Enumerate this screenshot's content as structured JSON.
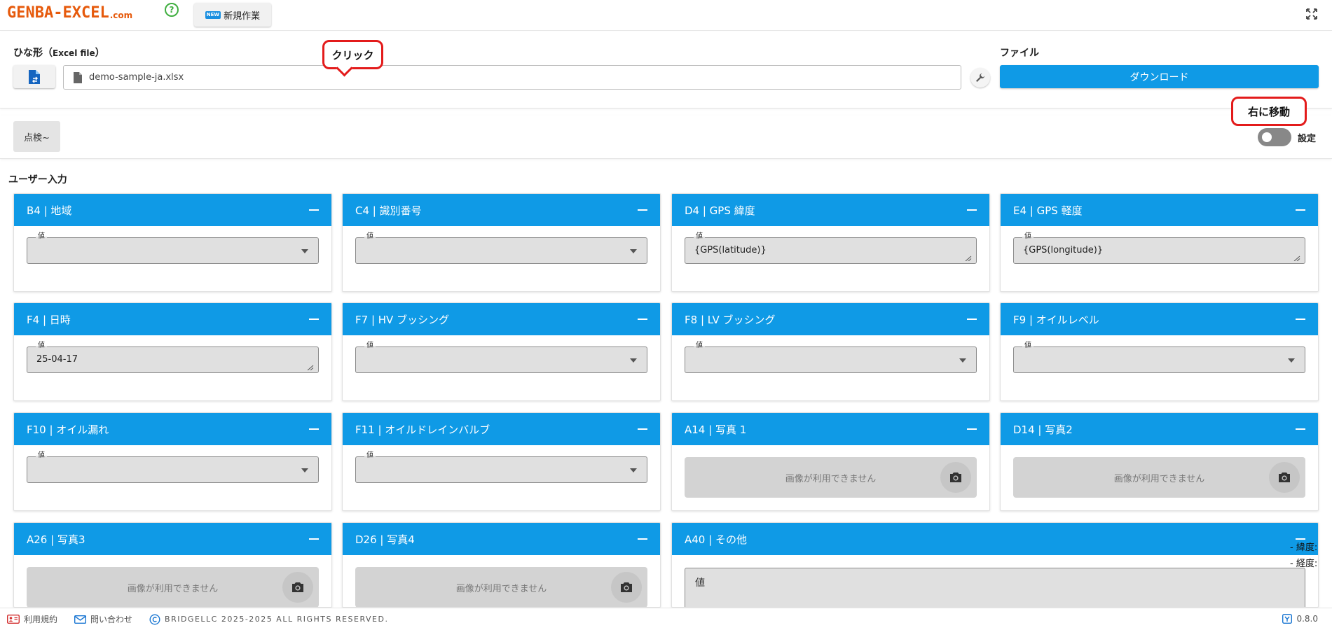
{
  "header": {
    "logo_text": "GENBA-EXCEL",
    "logo_suffix": ".com",
    "help_symbol": "?",
    "new_badge": "NEW",
    "new_work_label": "新規作業",
    "fullscreen_icon": "fullscreen-icon"
  },
  "file_section": {
    "template_label": "ひな形（",
    "template_label_sub": "Excel file",
    "template_label_end": "）",
    "file_name": "demo-sample-ja.xlsx",
    "file_label": "ファイル",
    "download_label": "ダウンロード"
  },
  "callouts": {
    "click": "クリック",
    "move_right": "右に移動"
  },
  "mode_bar": {
    "mode_button": "点検~",
    "toggle_label": "設定",
    "toggle_on": false
  },
  "user_input": {
    "title": "ユーザー入力",
    "value_label": "値",
    "no_image": "画像が利用できません",
    "cards": [
      {
        "title": "B4 | 地域",
        "type": "select",
        "value": ""
      },
      {
        "title": "C4 | 識別番号",
        "type": "select",
        "value": ""
      },
      {
        "title": "D4 | GPS 緯度",
        "type": "text",
        "value": "{GPS(latitude)}"
      },
      {
        "title": "E4 | GPS 軽度",
        "type": "text",
        "value": "{GPS(longitude)}"
      },
      {
        "title": "F4 | 日時",
        "type": "text",
        "value": "25-04-17"
      },
      {
        "title": "F7 | HV ブッシング",
        "type": "select",
        "value": ""
      },
      {
        "title": "F8 | LV ブッシング",
        "type": "select",
        "value": ""
      },
      {
        "title": "F9 | オイルレベル",
        "type": "select",
        "value": ""
      },
      {
        "title": "F10 | オイル漏れ",
        "type": "select",
        "value": ""
      },
      {
        "title": "F11 | オイルドレインバルブ",
        "type": "select",
        "value": ""
      },
      {
        "title": "A14 | 写真 1",
        "type": "image"
      },
      {
        "title": "D14 | 写真2",
        "type": "image"
      },
      {
        "title": "A26 | 写真3",
        "type": "image"
      },
      {
        "title": "D26 | 写真4",
        "type": "image"
      },
      {
        "title": "A40 | その他",
        "type": "textarea",
        "placeholder": "値"
      }
    ],
    "geo_lat": "- 緯度:",
    "geo_lng": "- 経度:"
  },
  "footer": {
    "terms": "利用規約",
    "contact": "問い合わせ",
    "copyright": "BRIDGELLC 2025-2025 ALL RIGHTS RESERVED.",
    "version": "0.8.0"
  },
  "colors": {
    "accent": "#0f9ae6",
    "logo": "#e65a0c",
    "callout": "#e31b1b"
  }
}
